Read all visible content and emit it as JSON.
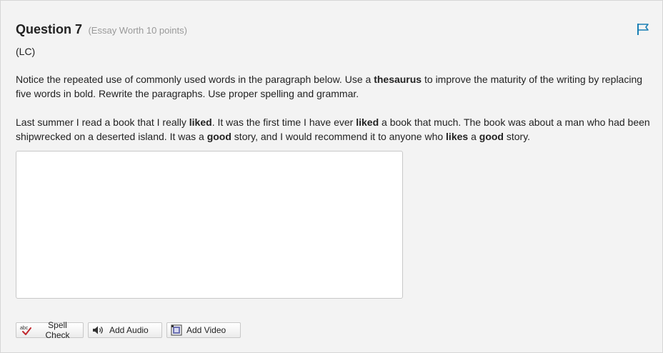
{
  "question": {
    "title": "Question 7",
    "worth": "(Essay Worth 10 points)",
    "tag": "(LC)"
  },
  "instructions": {
    "t1": "Notice the repeated use of commonly used words in the paragraph below. Use a ",
    "b1": "thesaurus",
    "t2": " to improve the maturity of the writing by replacing five words in bold. Rewrite the paragraphs. Use proper spelling and grammar."
  },
  "passage": {
    "t1": "Last summer I read a book that I really ",
    "b1": "liked",
    "t2": ". It was the first time I have ever ",
    "b2": "liked",
    "t3": " a book that much. The book was about a man who had been shipwrecked on a deserted island. It was a ",
    "b3": "good",
    "t4": " story, and I would recommend it to anyone who ",
    "b4": "likes",
    "t5": " a ",
    "b5": "good",
    "t6": " story."
  },
  "answer": {
    "value": ""
  },
  "toolbar": {
    "spell_check": "Spell Check",
    "add_audio": "Add Audio",
    "add_video": "Add Video"
  },
  "icons": {
    "flag": "flag-icon",
    "spell": "spell-check-icon",
    "audio": "speaker-icon",
    "video": "video-icon"
  },
  "colors": {
    "flag": "#1a7fb5",
    "muted": "#999999"
  }
}
